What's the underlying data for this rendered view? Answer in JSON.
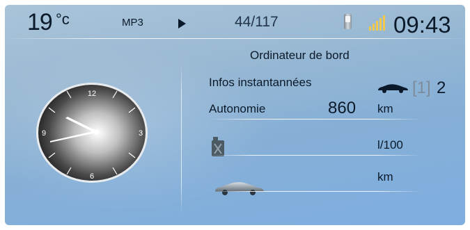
{
  "status_bar": {
    "temperature": "19",
    "temperature_unit": "°c",
    "source": "MP3",
    "track": "44/117",
    "time": "09:43"
  },
  "trip_computer": {
    "title": "Ordinateur de bord",
    "instant_info_label": "Infos instantannées",
    "trip_bracket": "[1]",
    "trip_number": "2",
    "range_label": "Autonomie",
    "range_value": "860",
    "range_unit": "km",
    "consumption_unit": "l/100",
    "distance_unit": "km"
  },
  "analog_clock": {
    "numerals": [
      "12",
      "3",
      "6",
      "9"
    ]
  },
  "icons": {
    "play": "play-icon",
    "phone": "phone-icon",
    "signal": "signal-strength-icon",
    "car_small": "car-icon",
    "fuel": "fuel-can-icon",
    "car_large": "car-icon"
  },
  "colors": {
    "screen_top": "#a9c4d9",
    "screen_bottom": "#7eaee0",
    "text": "#0b1a2a",
    "signal_bars": "#f2c94c",
    "bracket": "#7d8c9c"
  }
}
